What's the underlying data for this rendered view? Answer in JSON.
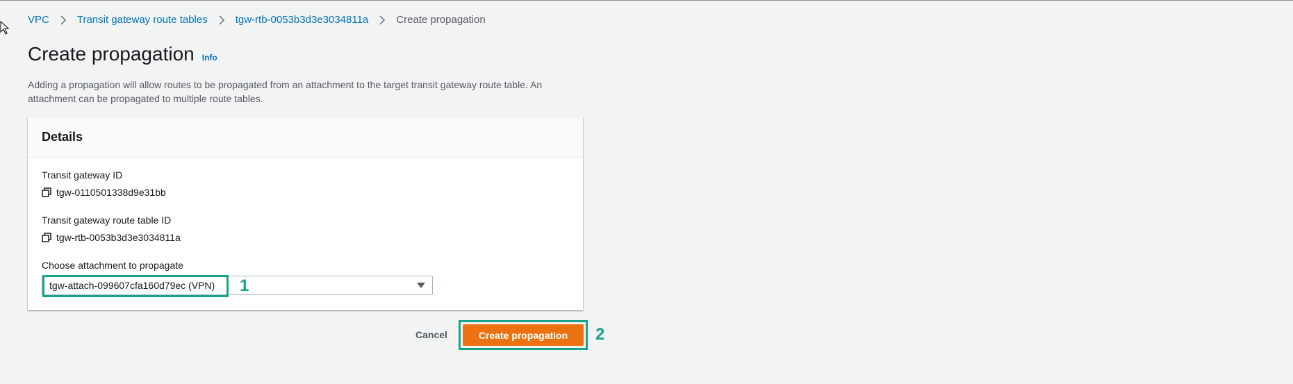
{
  "breadcrumb": {
    "items": [
      {
        "label": "VPC"
      },
      {
        "label": "Transit gateway route tables"
      },
      {
        "label": "tgw-rtb-0053b3d3e3034811a"
      }
    ],
    "current": "Create propagation"
  },
  "header": {
    "title": "Create propagation",
    "info_label": "Info",
    "description": "Adding a propagation will allow routes to be propagated from an attachment to the target transit gateway route table. An attachment can be propagated to multiple route tables."
  },
  "details": {
    "title": "Details",
    "transit_gateway_id_label": "Transit gateway ID",
    "transit_gateway_id_value": "tgw-0110501338d9e31bb",
    "route_table_id_label": "Transit gateway route table ID",
    "route_table_id_value": "tgw-rtb-0053b3d3e3034811a",
    "attachment_label": "Choose attachment to propagate",
    "attachment_selected": "tgw-attach-099607cfa160d79ec (VPN)"
  },
  "actions": {
    "cancel_label": "Cancel",
    "create_label": "Create propagation"
  },
  "annotations": {
    "step1": "1",
    "step2": "2"
  },
  "colors": {
    "link": "#0073bb",
    "primary_button": "#ec7211",
    "annotation": "#1aa38b",
    "background": "#f2f3f3"
  },
  "icons": [
    "chevron-right-icon",
    "copy-icon",
    "caret-down-icon",
    "mouse-cursor-icon"
  ]
}
